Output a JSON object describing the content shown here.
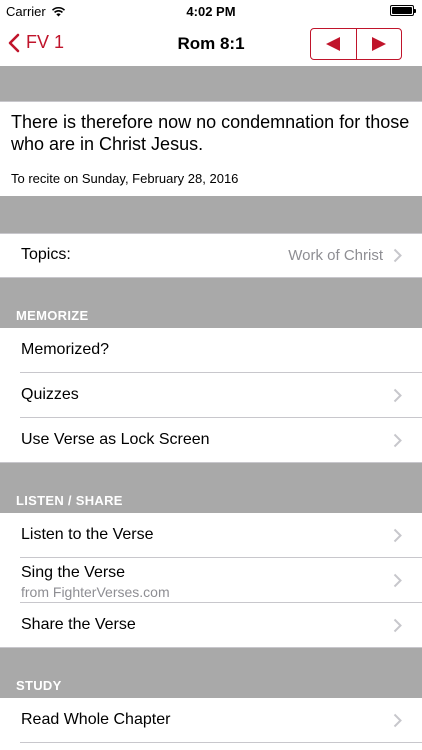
{
  "status_bar": {
    "carrier": "Carrier",
    "time": "4:02 PM"
  },
  "nav": {
    "back_label": "FV 1",
    "title": "Rom 8:1",
    "accent_color": "#c0142b",
    "prev_icon": "triangle-left-icon",
    "next_icon": "triangle-right-icon"
  },
  "verse": {
    "text": "There is therefore now no condemnation for those who are in Christ Jesus.",
    "recite_date": "To recite on Sunday, February 28, 2016"
  },
  "topics": {
    "label": "Topics:",
    "value": "Work of Christ"
  },
  "sections": {
    "memorize": {
      "header": "MEMORIZE",
      "items": [
        {
          "label": "Memorized?"
        },
        {
          "label": "Quizzes"
        },
        {
          "label": "Use Verse as Lock Screen"
        }
      ]
    },
    "listen_share": {
      "header": "LISTEN / SHARE",
      "items": [
        {
          "label": "Listen to the Verse"
        },
        {
          "label": "Sing the Verse",
          "sublabel": "from FighterVerses.com"
        },
        {
          "label": "Share the Verse"
        }
      ]
    },
    "study": {
      "header": "STUDY",
      "items": [
        {
          "label": "Read Whole Chapter"
        }
      ]
    }
  }
}
